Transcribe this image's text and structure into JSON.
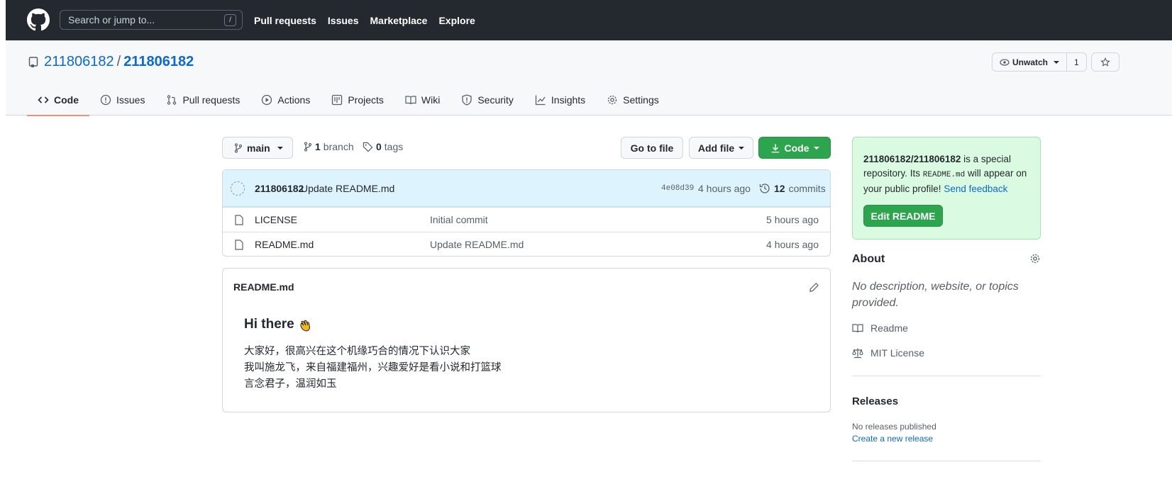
{
  "header": {
    "search_placeholder": "Search or jump to...",
    "search_shortcut": "/",
    "nav": [
      "Pull requests",
      "Issues",
      "Marketplace",
      "Explore"
    ]
  },
  "repo": {
    "owner": "211806182",
    "separator": "/",
    "name": "211806182",
    "unwatch_label": "Unwatch",
    "watch_count": "1"
  },
  "tabs": [
    "Code",
    "Issues",
    "Pull requests",
    "Actions",
    "Projects",
    "Wiki",
    "Security",
    "Insights",
    "Settings"
  ],
  "controls": {
    "branch": "main",
    "branch_count": "1",
    "branch_word": "branch",
    "tag_count": "0",
    "tag_word": "tags",
    "go_to_file": "Go to file",
    "add_file": "Add file",
    "code": "Code"
  },
  "latest_commit": {
    "author": "211806182",
    "message": "Update README.md",
    "sha": "4e08d39",
    "age": "4 hours ago",
    "commit_count": "12",
    "commit_word": "commits"
  },
  "files": [
    {
      "name": "LICENSE",
      "message": "Initial commit",
      "age": "5 hours ago"
    },
    {
      "name": "README.md",
      "message": "Update README.md",
      "age": "4 hours ago"
    }
  ],
  "readme": {
    "title": "README.md",
    "heading": "Hi there",
    "lines": [
      "大家好，很高兴在这个机缘巧合的情况下认识大家",
      "我叫施龙飞，来自福建福州，兴趣爱好是看小说和打篮球",
      "言念君子，温润如玉"
    ]
  },
  "sidebar": {
    "promo_repo": "211806182/211806182",
    "promo_text1": " is a special repository. Its ",
    "promo_code": "README.md",
    "promo_text2": " will appear on your public profile! ",
    "promo_link": "Send feedback",
    "edit_readme": "Edit README",
    "about_title": "About",
    "about_desc": "No description, website, or topics provided.",
    "readme_link": "Readme",
    "license_link": "MIT License",
    "releases_title": "Releases",
    "no_releases": "No releases published",
    "create_release": "Create a new release"
  },
  "colors": {
    "header_bg": "#24292f",
    "accent_green": "#2da44e",
    "link_blue": "#0969da",
    "tab_underline": "#fd8c73"
  }
}
